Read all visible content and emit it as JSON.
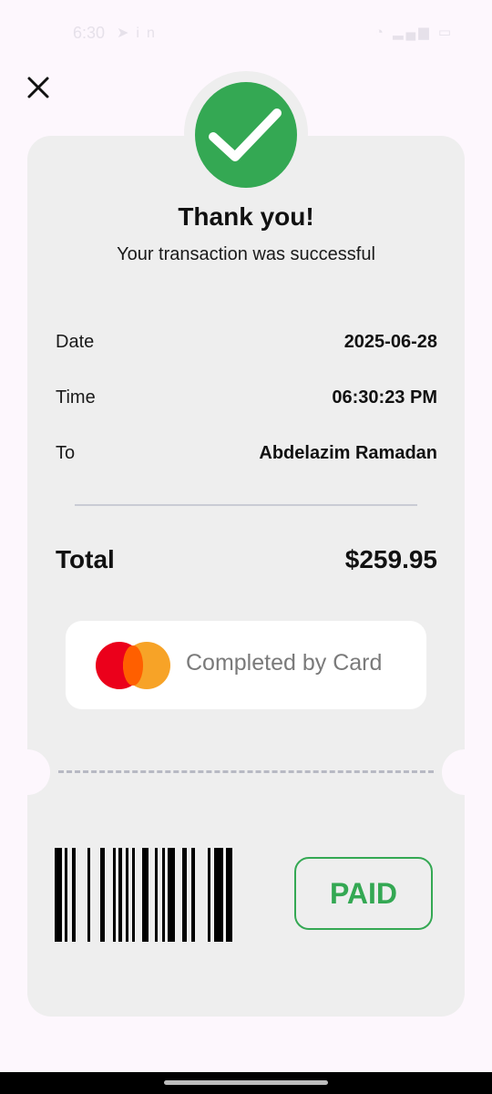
{
  "status_bar": {
    "time": "6:30",
    "left_icons": [
      "navigation-icon",
      "linkedin-icon"
    ],
    "right_icons": [
      "wifi-icon",
      "signal-icon",
      "battery-icon"
    ]
  },
  "close_icon": "close-icon",
  "success_icon": "checkmark-icon",
  "header": {
    "title": "Thank you!",
    "subtitle": "Your transaction was successful"
  },
  "details": [
    {
      "label": "Date",
      "value": "2025-06-28"
    },
    {
      "label": "Time",
      "value": "06:30:23 PM"
    },
    {
      "label": "To",
      "value": "Abdelazim Ramadan"
    }
  ],
  "total": {
    "label": "Total",
    "value": "$259.95"
  },
  "payment": {
    "icon": "mastercard-icon",
    "label": "Completed by Card"
  },
  "barcode_icon": "barcode-icon",
  "paid_label": "PAID",
  "colors": {
    "success": "#34a853",
    "card_bg": "#eeeeee",
    "page_bg": "#fdf7fd",
    "mc_red": "#eb001b",
    "mc_orange": "#f79e1b"
  }
}
